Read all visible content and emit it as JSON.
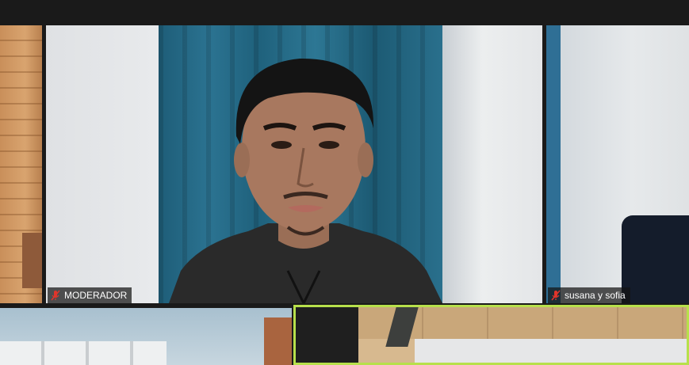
{
  "app": "video-conference-gallery",
  "participants": [
    {
      "name": "MODERADOR",
      "muted": true
    },
    {
      "name": "susana y sofia",
      "muted": true
    }
  ],
  "active_speaker_highlight_color": "#b7e04b",
  "muted_icon_color": "#e0352b"
}
